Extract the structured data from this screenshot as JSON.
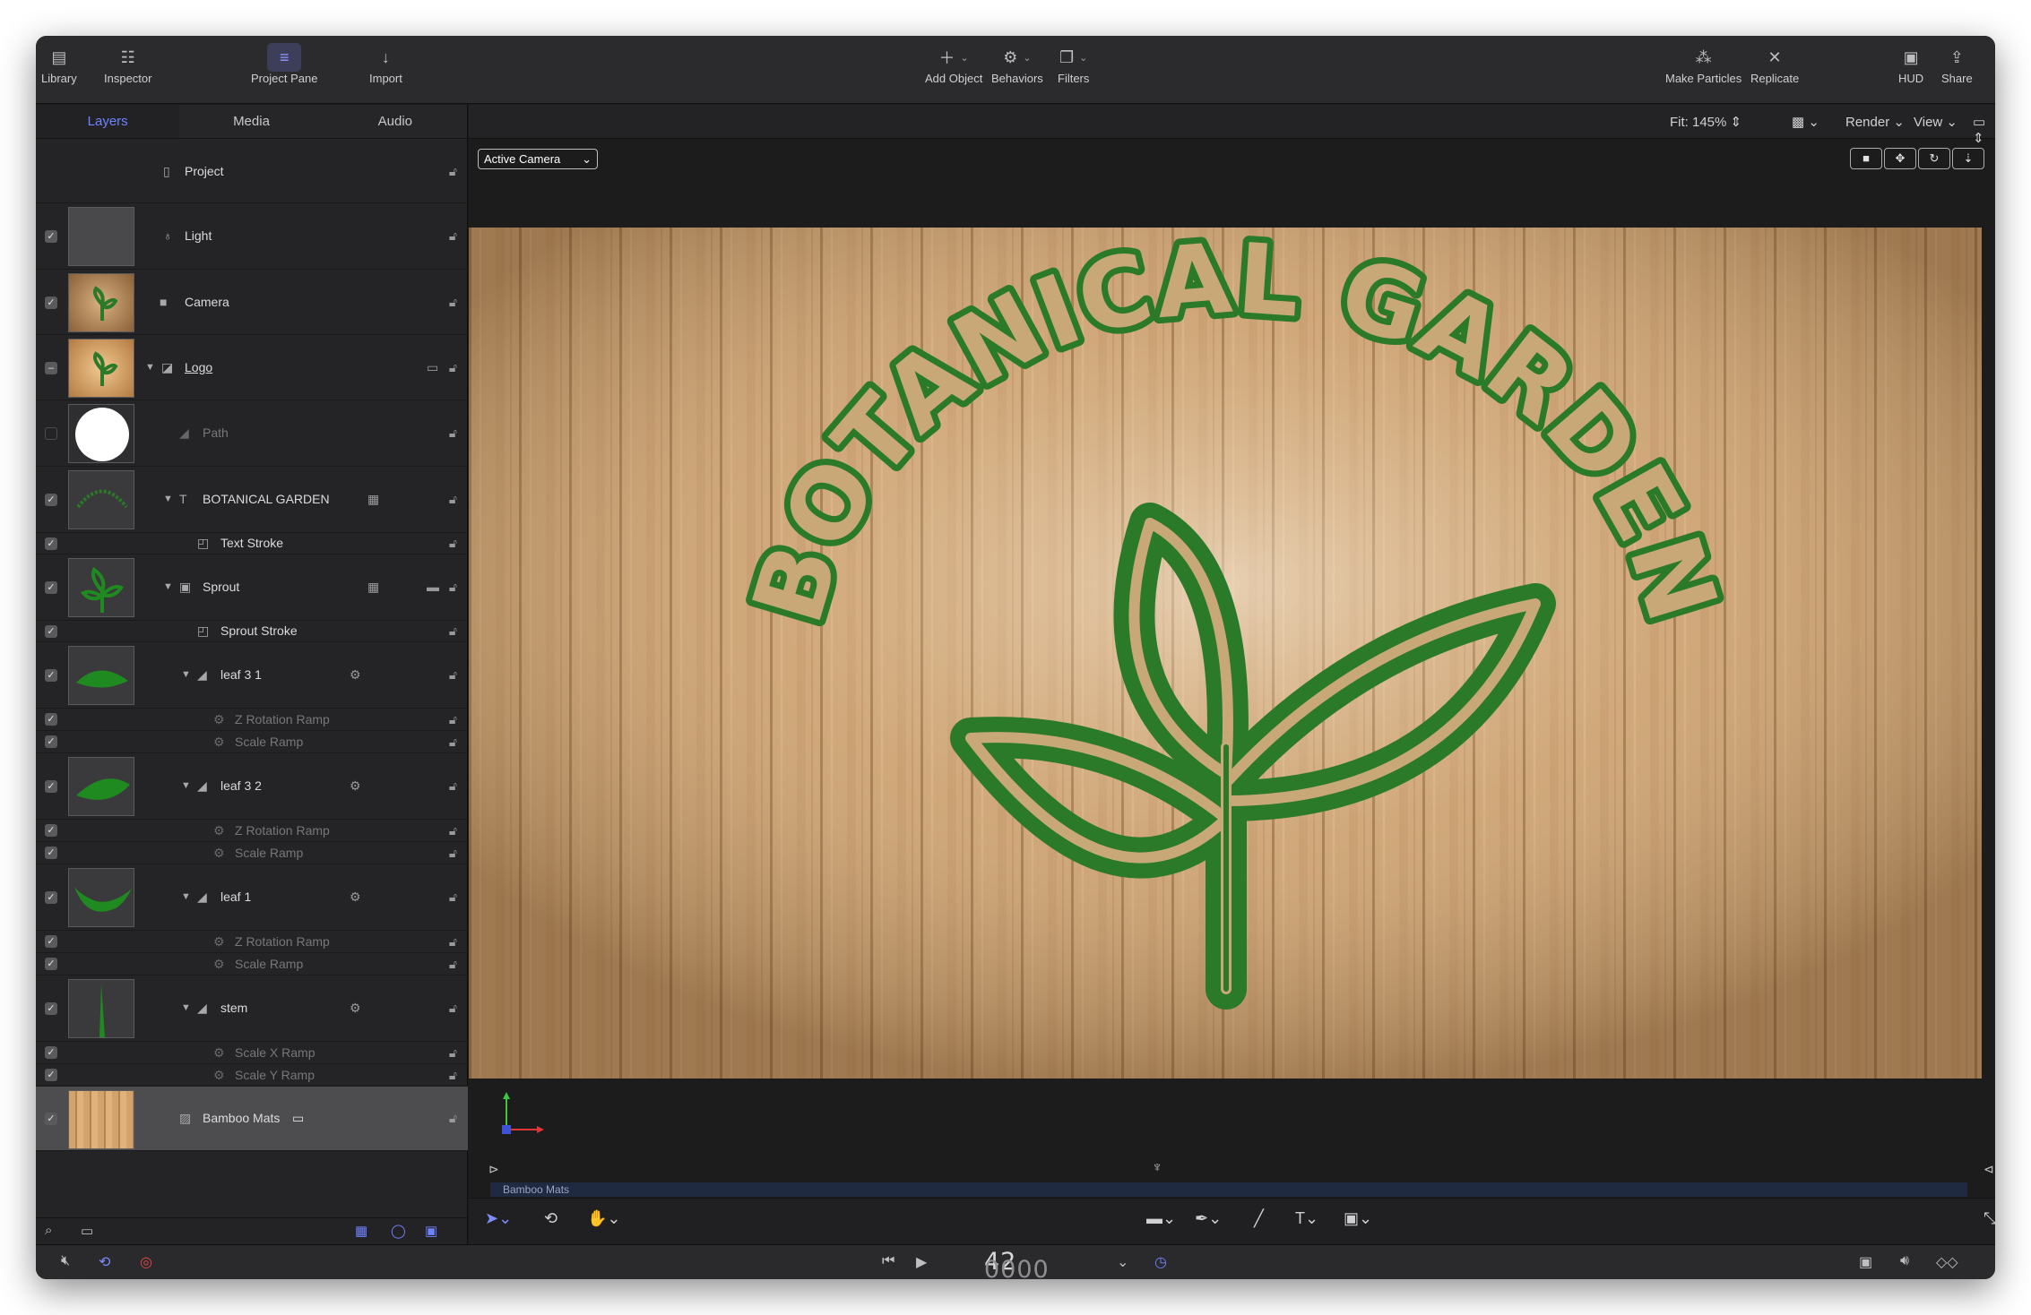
{
  "toolbar": {
    "library": "Library",
    "inspector": "Inspector",
    "project_pane": "Project Pane",
    "import": "Import",
    "add_object": "Add Object",
    "behaviors": "Behaviors",
    "filters": "Filters",
    "make_particles": "Make Particles",
    "replicate": "Replicate",
    "hud": "HUD",
    "share": "Share"
  },
  "tabs": [
    "Layers",
    "Media",
    "Audio"
  ],
  "layers": [
    {
      "name": "Project"
    },
    {
      "name": "Light"
    },
    {
      "name": "Camera"
    },
    {
      "name": "Logo"
    },
    {
      "name": "Path"
    },
    {
      "name": "BOTANICAL GARDEN"
    },
    {
      "name": "Text Stroke"
    },
    {
      "name": "Sprout"
    },
    {
      "name": "Sprout Stroke"
    },
    {
      "name": "leaf 3 1"
    },
    {
      "name": "Z Rotation Ramp"
    },
    {
      "name": "Scale Ramp"
    },
    {
      "name": "leaf 3 2"
    },
    {
      "name": "Z Rotation Ramp"
    },
    {
      "name": "Scale Ramp"
    },
    {
      "name": "leaf 1"
    },
    {
      "name": "Z Rotation Ramp"
    },
    {
      "name": "Scale Ramp"
    },
    {
      "name": "stem"
    },
    {
      "name": "Scale X Ramp"
    },
    {
      "name": "Scale Y Ramp"
    },
    {
      "name": "Bamboo Mats"
    }
  ],
  "canvas": {
    "fit": "Fit: 145%",
    "render": "Render",
    "view": "View",
    "camera": "Active Camera",
    "title_text": "BOTANICAL GARDEN"
  },
  "timeline": {
    "clip": "Bamboo Mats"
  },
  "transport": {
    "timecode_dim": "0000",
    "timecode": "42"
  },
  "colors": {
    "accent": "#6f82ff",
    "logo_green": "#2a7a2a",
    "wood": "#c9a37a"
  }
}
